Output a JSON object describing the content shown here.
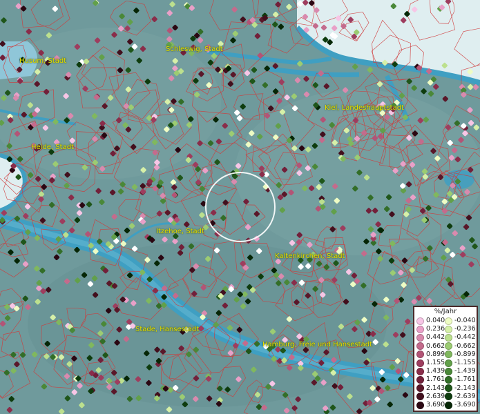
{
  "places": [
    {
      "name": "Husum, Stadt"
    },
    {
      "name": "Schleswig, Stadt"
    },
    {
      "name": "Kiel, Landeshauptstadt"
    },
    {
      "name": "Heide, Stadt"
    },
    {
      "name": "Itzehoe, Stadt"
    },
    {
      "name": "Kaltenkirchen, Stadt"
    },
    {
      "name": "Stade, Hansestadt"
    },
    {
      "name": "Hamburg, Freie und Hansestadt"
    }
  ],
  "legend": {
    "title": "%/Jahr",
    "positive": [
      {
        "value": "0.040",
        "color": "#f7c6e6"
      },
      {
        "value": "0.236",
        "color": "#e9a0c8"
      },
      {
        "value": "0.442",
        "color": "#d98aae"
      },
      {
        "value": "0.662",
        "color": "#c46b8c"
      },
      {
        "value": "0.899",
        "color": "#b35476"
      },
      {
        "value": "1.155",
        "color": "#9e3d5e"
      },
      {
        "value": "1.439",
        "color": "#8a2d4a"
      },
      {
        "value": "1.761",
        "color": "#72203a"
      },
      {
        "value": "2.143",
        "color": "#5a1729"
      },
      {
        "value": "2.639",
        "color": "#420f1d"
      },
      {
        "value": "3.690",
        "color": "#2a0712"
      }
    ],
    "negative": [
      {
        "value": "-0.040",
        "color": "#eefcc4"
      },
      {
        "value": "-0.236",
        "color": "#d6f0a8"
      },
      {
        "value": "-0.442",
        "color": "#bce08e"
      },
      {
        "value": "-0.662",
        "color": "#9ccc72"
      },
      {
        "value": "-0.899",
        "color": "#80b85e"
      },
      {
        "value": "-1.155",
        "color": "#62a04a"
      },
      {
        "value": "-1.439",
        "color": "#4a8838"
      },
      {
        "value": "-1.761",
        "color": "#336e28"
      },
      {
        "value": "-2.143",
        "color": "#1f561a"
      },
      {
        "value": "-2.639",
        "color": "#0e3c0e"
      },
      {
        "value": "-3.690",
        "color": "#062606"
      }
    ]
  },
  "colors": {
    "land": "#6f9a9c",
    "water": "#3f9fc2",
    "sea": "#dfeef0",
    "borders": "#d03a3a",
    "labels": "#e8e000",
    "highlight_ring": "#ffffff"
  }
}
